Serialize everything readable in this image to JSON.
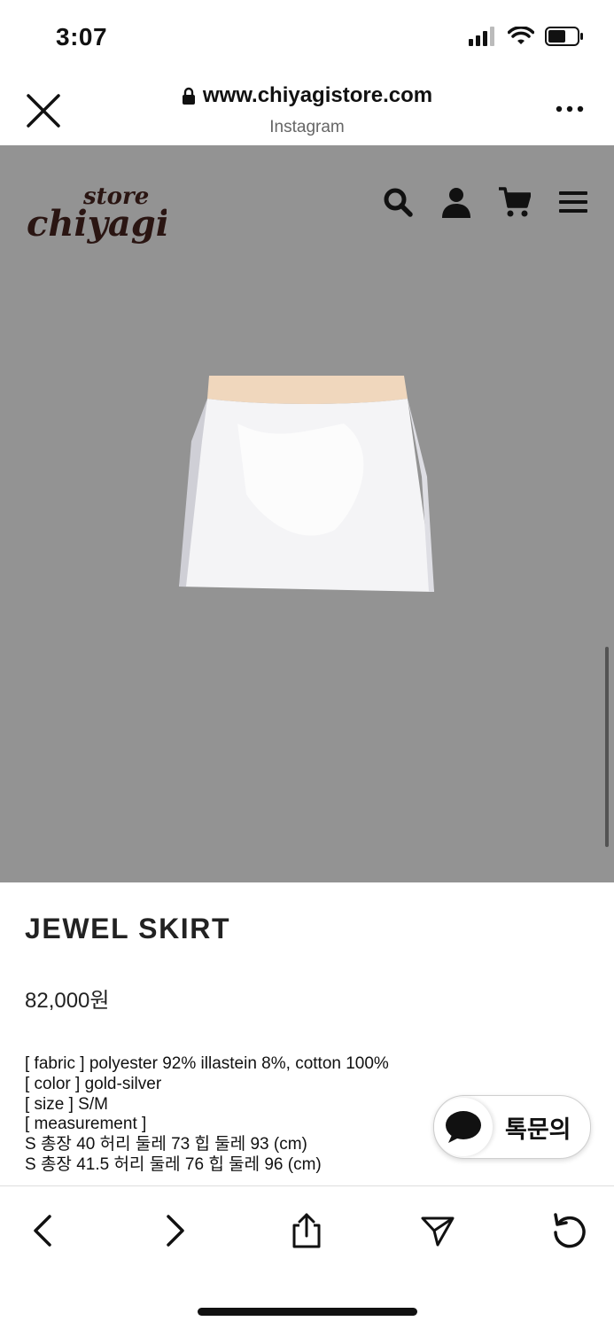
{
  "status_bar": {
    "time": "3:07"
  },
  "browser": {
    "url": "www.chiyagistore.com",
    "source": "Instagram"
  },
  "site": {
    "logo_top": "store",
    "logo_main": "chiyagi"
  },
  "product": {
    "name": "JEWEL SKIRT",
    "price": "82,000원",
    "details": [
      "[ fabric ] polyester 92% illastein 8%, cotton 100%",
      "[ color ] gold-silver",
      "[ size ] S/M",
      "[ measurement ]",
      "S 총장 40 허리 둘레 73 힙 둘레 93 (cm)",
      "S 총장 41.5 허리 둘레 76 힙 둘레 96 (cm)"
    ]
  },
  "chat": {
    "label": "톡문의"
  },
  "colors": {
    "hero_bg": "#939393",
    "logo": "#2a1512"
  }
}
